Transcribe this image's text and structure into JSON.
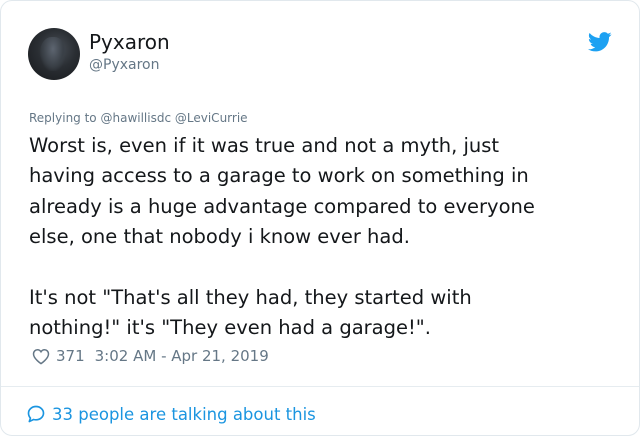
{
  "colors": {
    "twitter_blue": "#1da1f2",
    "link_blue": "#1b95e0",
    "text_primary": "#14171a",
    "text_secondary": "#657786",
    "border": "#e1e8ed"
  },
  "author": {
    "display_name": "Pyxaron",
    "handle": "@Pyxaron",
    "avatar_icon": "user-avatar"
  },
  "brand_icon": "twitter-bird-icon",
  "reply": {
    "prefix": "Replying to",
    "mentions": [
      "@hawillisdc",
      "@LeviCurrie"
    ]
  },
  "tweet": {
    "text": "Worst is, even if it was true and not a myth, just\nhaving access to a garage to work on something in\nalready is a huge advantage compared to everyone\nelse, one that nobody i know ever had.\n\nIt's not \"That's all they had, they started with\nnothing!\" it's \"They even had a garage!\"."
  },
  "meta": {
    "like_icon": "heart-icon",
    "like_count": "371",
    "timestamp": "3:02 AM - Apr 21, 2019"
  },
  "footer": {
    "icon": "speech-bubble-icon",
    "talking_label": "33 people are talking about this"
  }
}
